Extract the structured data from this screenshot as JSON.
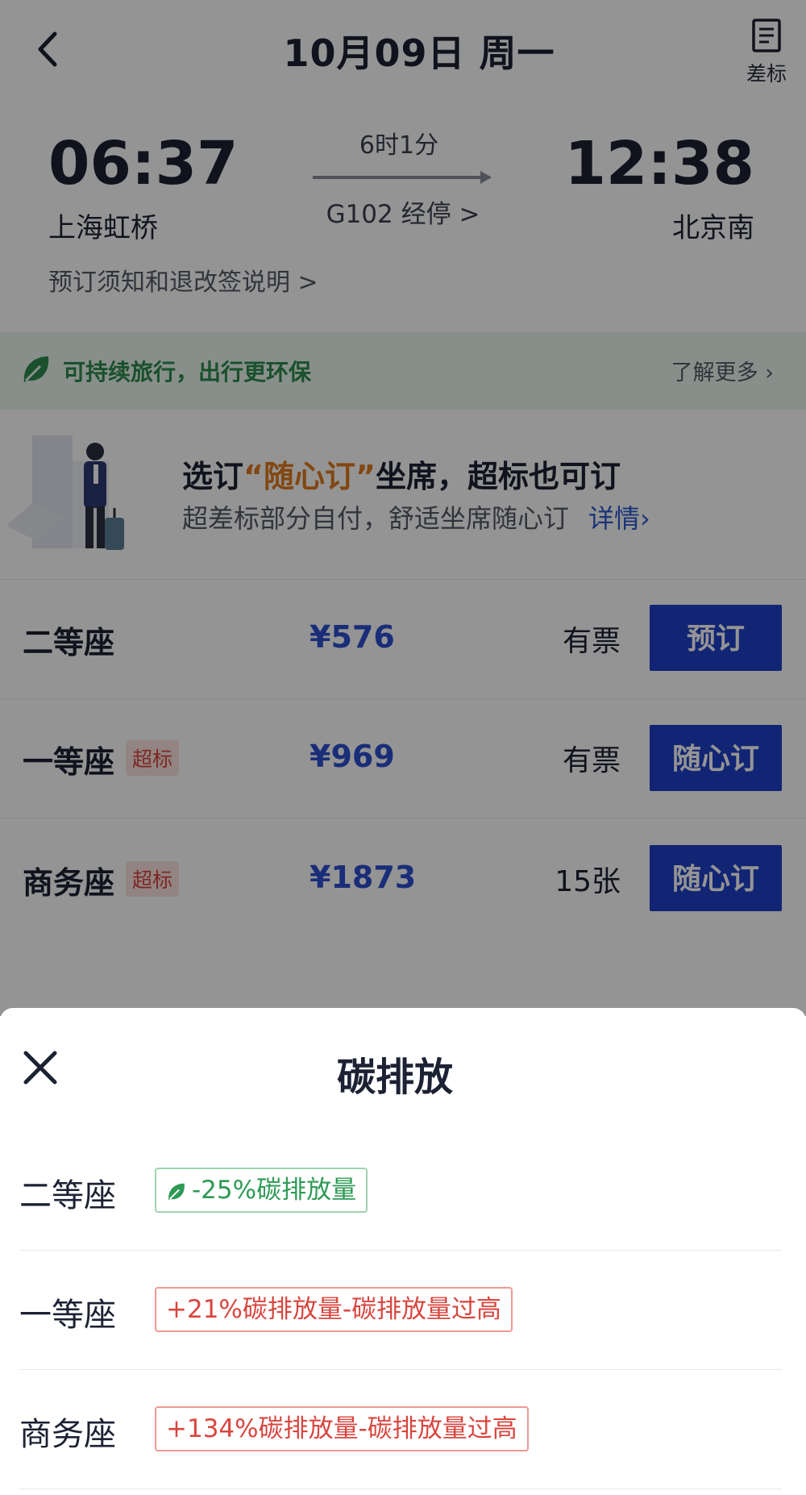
{
  "nav": {
    "date_title": "10月09日 周一",
    "diff_label": "差标"
  },
  "trip": {
    "dep_time": "06:37",
    "dep_station": "上海虹桥",
    "arr_time": "12:38",
    "arr_station": "北京南",
    "duration": "6时1分",
    "train_no": "G102  经停 >",
    "notice": "预订须知和退改签说明 >"
  },
  "eco": {
    "text": "可持续旅行，出行更环保",
    "more": "了解更多 ›"
  },
  "banner": {
    "title_pre": "选订",
    "title_hl": "“随心订”",
    "title_post": "坐席，超标也可订",
    "sub": "超差标部分自付，舒适坐席随心订",
    "link": "详情›"
  },
  "seats": [
    {
      "name": "二等座",
      "badge": "",
      "price": "¥576",
      "avail": "有票",
      "btn": "预订"
    },
    {
      "name": "一等座",
      "badge": "超标",
      "price": "¥969",
      "avail": "有票",
      "btn": "随心订"
    },
    {
      "name": "商务座",
      "badge": "超标",
      "price": "¥1873",
      "avail": "15张",
      "btn": "随心订"
    }
  ],
  "sheet": {
    "title": "碳排放",
    "rows": [
      {
        "name": "二等座",
        "tag": "-25%碳排放量",
        "level": "good"
      },
      {
        "name": "一等座",
        "tag": "+21%碳排放量-碳排放量过高",
        "level": "bad"
      },
      {
        "name": "商务座",
        "tag": "+134%碳排放量-碳排放量过高",
        "level": "bad"
      }
    ]
  },
  "colors": {
    "primary": "#1f41c8",
    "price": "#2d4fd0",
    "eco_green": "#2e9a55",
    "warn_red": "#d8463f",
    "highlight": "#e07a1f"
  },
  "icons": {
    "back": "chevron-left-icon",
    "diff": "document-icon",
    "leaf": "leaf-icon",
    "close": "close-icon"
  }
}
